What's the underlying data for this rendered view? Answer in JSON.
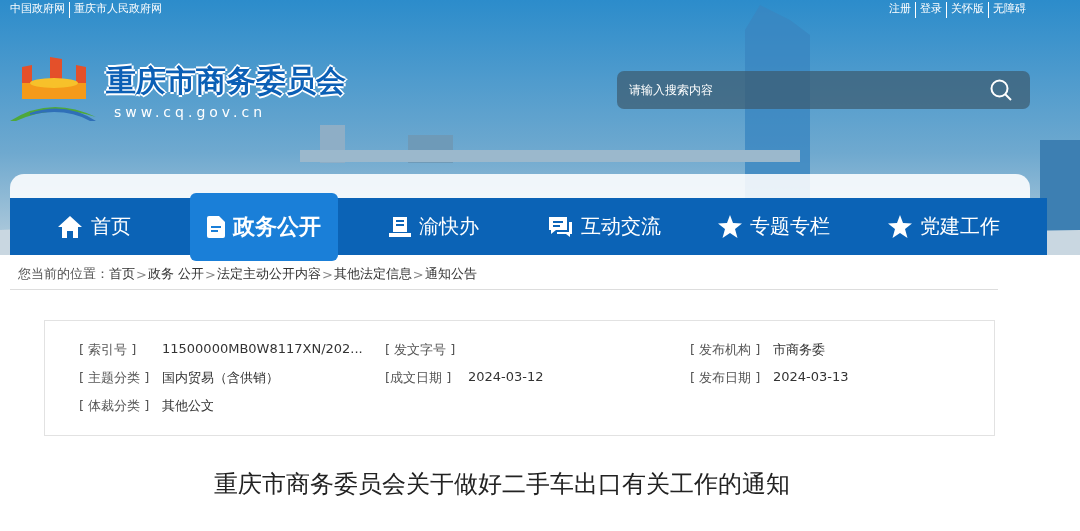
{
  "top_links_left": [
    "中国政府网",
    "重庆市人民政府网"
  ],
  "top_links_right": [
    "注册",
    "登录",
    "关怀版",
    "无障碍"
  ],
  "site": {
    "title": "重庆市商务委员会",
    "domain": "sww.cq.gov.cn"
  },
  "search": {
    "placeholder": "请输入搜索内容"
  },
  "nav": [
    {
      "label": "首页",
      "kind": "home",
      "selected": false
    },
    {
      "label": "政务公开",
      "kind": "doc",
      "selected": true
    },
    {
      "label": "渝快办",
      "kind": "desk",
      "selected": false
    },
    {
      "label": "互动交流",
      "kind": "chat",
      "selected": false
    },
    {
      "label": "专题专栏",
      "kind": "star",
      "selected": false
    },
    {
      "label": "党建工作",
      "kind": "star",
      "selected": false
    }
  ],
  "breadcrumb": [
    {
      "kind": "label",
      "text": "您当前的位置："
    },
    {
      "kind": "link",
      "text": "首页"
    },
    {
      "kind": "sep",
      "text": ">"
    },
    {
      "kind": "link",
      "text": "政务 公开"
    },
    {
      "kind": "sep",
      "text": ">"
    },
    {
      "kind": "link",
      "text": "法定主动公开内容"
    },
    {
      "kind": "sep",
      "text": ">"
    },
    {
      "kind": "link",
      "text": "其他法定信息"
    },
    {
      "kind": "sep",
      "text": ">"
    },
    {
      "kind": "link",
      "text": "通知公告"
    }
  ],
  "info": [
    [
      {
        "label": "[ 索引号 ]",
        "value": "11500000MB0W8117XN/202..."
      },
      {
        "label": "[ 发文字号 ]"
      },
      {
        "label": "[ 发布机构 ]",
        "value": "市商务委"
      }
    ],
    [
      {
        "label": "[ 主题分类 ]",
        "value": "国内贸易（含供销）"
      },
      {
        "label": "[成文日期 ]",
        "value": "2024-03-12"
      },
      {
        "label": "[ 发布日期 ]",
        "value": "2024-03-13"
      }
    ],
    [
      {
        "label": "[ 体裁分类 ]",
        "value": "其他公文"
      }
    ]
  ],
  "article_title": "重庆市商务委员会关于做好二手车出口有关工作的通知"
}
